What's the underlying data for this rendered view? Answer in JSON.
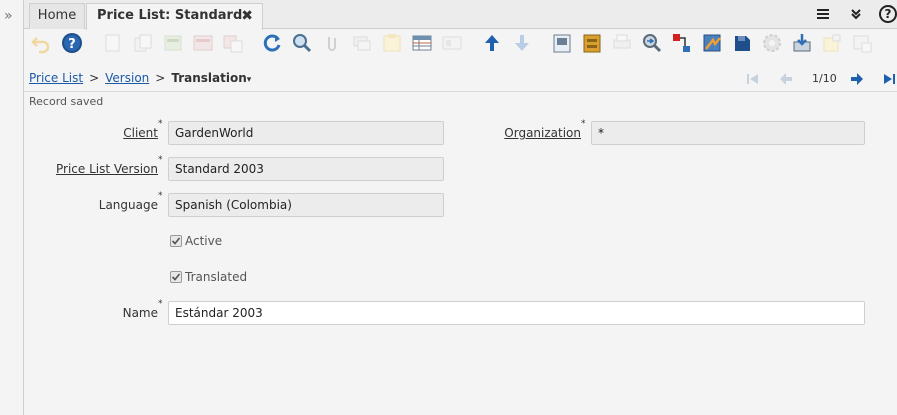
{
  "tabs": {
    "home_label": "Home",
    "active_label": "Price List: Standard",
    "close_glyph": "✖"
  },
  "tab_tools": {
    "menu_icon": "hamburger-menu-icon",
    "collapse_icon": "double-chevron-down-icon",
    "help_glyph": "?"
  },
  "toolbar_icons": [
    "undo-icon",
    "help-icon",
    "new-icon",
    "copy-icon",
    "delete-icon",
    "save-icon",
    "save-new-icon",
    "refresh-icon",
    "find-icon",
    "attachment-icon",
    "chat-icon",
    "history-icon",
    "grid-toggle-icon",
    "parent-icon",
    "previous-record-icon",
    "next-record-icon",
    "report-icon",
    "archive-icon",
    "print-icon",
    "zoom-across-icon",
    "active-workflows-icon",
    "requests-icon",
    "product-info-icon",
    "process-icon",
    "import-icon",
    "export-icon",
    "customize-icon"
  ],
  "breadcrumb": {
    "level1": "Price List",
    "level2": "Version",
    "current": "Translation",
    "separator": ">",
    "caret": "▾"
  },
  "pager": {
    "text": "1/10"
  },
  "status": {
    "message": "Record saved"
  },
  "form": {
    "client_label": "Client",
    "client_value": "GardenWorld",
    "organization_label": "Organization",
    "organization_value": "*",
    "price_list_version_label": "Price List Version",
    "price_list_version_value": "Standard 2003",
    "language_label": "Language",
    "language_value": "Spanish (Colombia)",
    "active_label": "Active",
    "active_checked": true,
    "translated_label": "Translated",
    "translated_checked": true,
    "name_label": "Name",
    "name_value": "Estándar 2003",
    "mandatory_marker": "*"
  },
  "colors": {
    "link": "#1a5aa8",
    "nav_blue": "#1e5fae",
    "background": "#f4f4f4"
  }
}
